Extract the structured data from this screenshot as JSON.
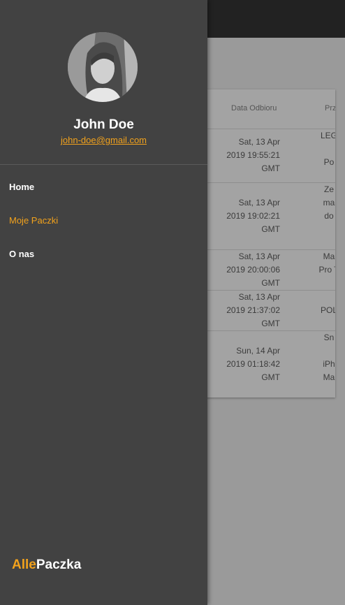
{
  "table": {
    "headers": [
      "Data Odbioru",
      "Prz"
    ],
    "rows": [
      {
        "date": [
          "Sat, 13 Apr",
          "2019 19:55:21",
          "GMT"
        ],
        "name": [
          "LEG",
          "",
          "Po"
        ]
      },
      {
        "date": [
          "Sat, 13 Apr",
          "2019 19:02:21",
          "GMT"
        ],
        "name": [
          "Ze",
          "ma",
          "do"
        ]
      },
      {
        "date": [
          "Sat, 13 Apr",
          "2019 20:00:06",
          "GMT"
        ],
        "name": [
          "Ma",
          "Pro T"
        ]
      },
      {
        "date": [
          "Sat, 13 Apr",
          "2019 21:37:02",
          "GMT"
        ],
        "name": [
          "",
          "POL"
        ]
      },
      {
        "date": [
          "Sun, 14 Apr",
          "2019 01:18:42",
          "GMT"
        ],
        "name": [
          "Sn",
          "",
          "iPh",
          "Ma"
        ]
      }
    ]
  },
  "drawer": {
    "user": {
      "name": "John Doe",
      "email": "john-doe@gmail.com"
    },
    "nav": [
      {
        "label": "Home",
        "active": false
      },
      {
        "label": "Moje Paczki",
        "active": true
      },
      {
        "label": "O nas",
        "active": false
      }
    ],
    "logo": {
      "part1": "Alle",
      "part2": "Paczka"
    }
  },
  "colors": {
    "accent": "#f2a21c",
    "drawer_bg": "#424242",
    "topbar": "#222222",
    "overlay": "#9a9a9a"
  }
}
